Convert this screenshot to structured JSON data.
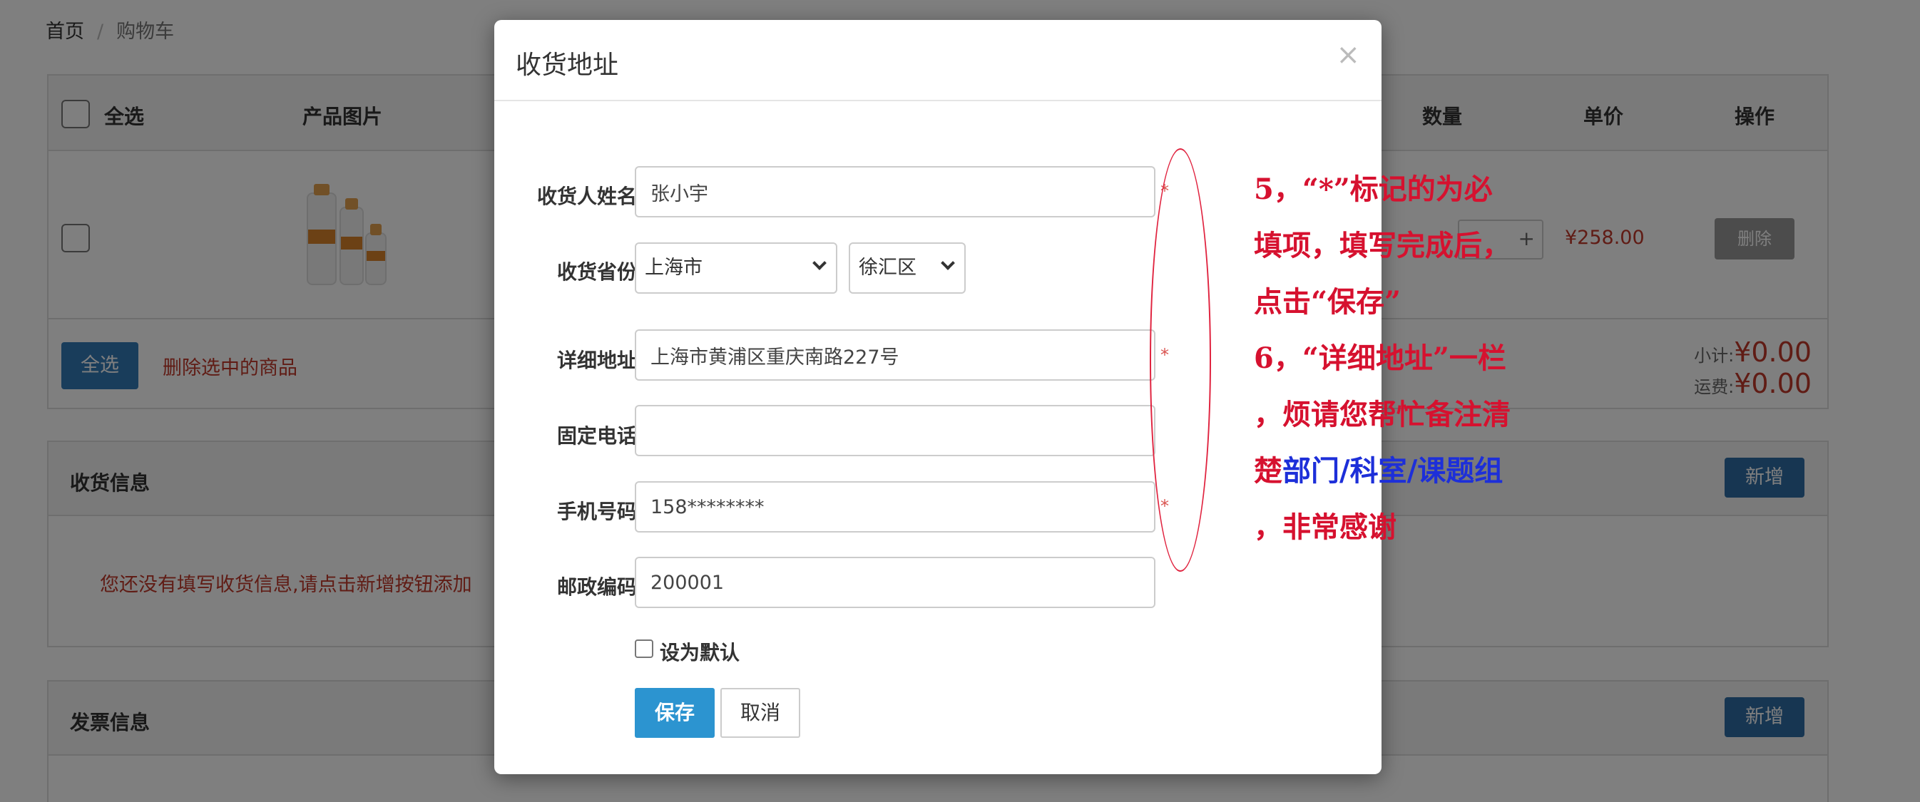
{
  "breadcrumb": {
    "home": "首页",
    "separator": "/",
    "current": "购物车"
  },
  "cart": {
    "headers": {
      "select_all": "全选",
      "image": "产品图片",
      "quantity": "数量",
      "unit_price": "单价",
      "action": "操作"
    },
    "row": {
      "price": "¥258.00",
      "delete_label": "删除",
      "qty_plus": "+"
    },
    "footer": {
      "select_all_button": "全选",
      "delete_selected": "删除选中的商品",
      "subtotal_label": "小计:",
      "subtotal_value": "¥0.00",
      "shipping_label": "运费:",
      "shipping_value": "¥0.00"
    }
  },
  "address_panel": {
    "title": "收货信息",
    "new_button": "新增",
    "empty_text": "您还没有填写收货信息,请点击新增按钮添加"
  },
  "invoice_panel": {
    "title": "发票信息",
    "new_button": "新增"
  },
  "modal": {
    "title": "收货地址",
    "close": "×",
    "fields": {
      "name": {
        "label": "收货人姓名",
        "value": "张小宇",
        "required": "*"
      },
      "province": {
        "label": "收货省份",
        "province_value": "上海市",
        "district_value": "徐汇区"
      },
      "address": {
        "label": "详细地址",
        "value": "上海市黄浦区重庆南路227号",
        "required": "*"
      },
      "phone": {
        "label": "固定电话",
        "value": ""
      },
      "mobile": {
        "label": "手机号码",
        "value": "158********",
        "required": "*"
      },
      "postcode": {
        "label": "邮政编码",
        "value": "200001"
      }
    },
    "default_label": "设为默认",
    "save_button": "保存",
    "cancel_button": "取消"
  },
  "annotation": {
    "line1": "5，“*”标记的为必",
    "line2": "填项，填写完成后，",
    "line3": "点击“保存”",
    "line4": "6，“详细地址”一栏",
    "line5": "，烦请您帮忙备注清",
    "line6_a": "楚",
    "line6_b": "部门/科室/课题组",
    "line7": "，非常感谢"
  },
  "colors": {
    "accent_blue": "#337ab7",
    "save_blue": "#2c94d0",
    "required_red": "#d9534f",
    "annotation_red": "#d6112f",
    "annotation_blue": "#1d2fd9"
  }
}
